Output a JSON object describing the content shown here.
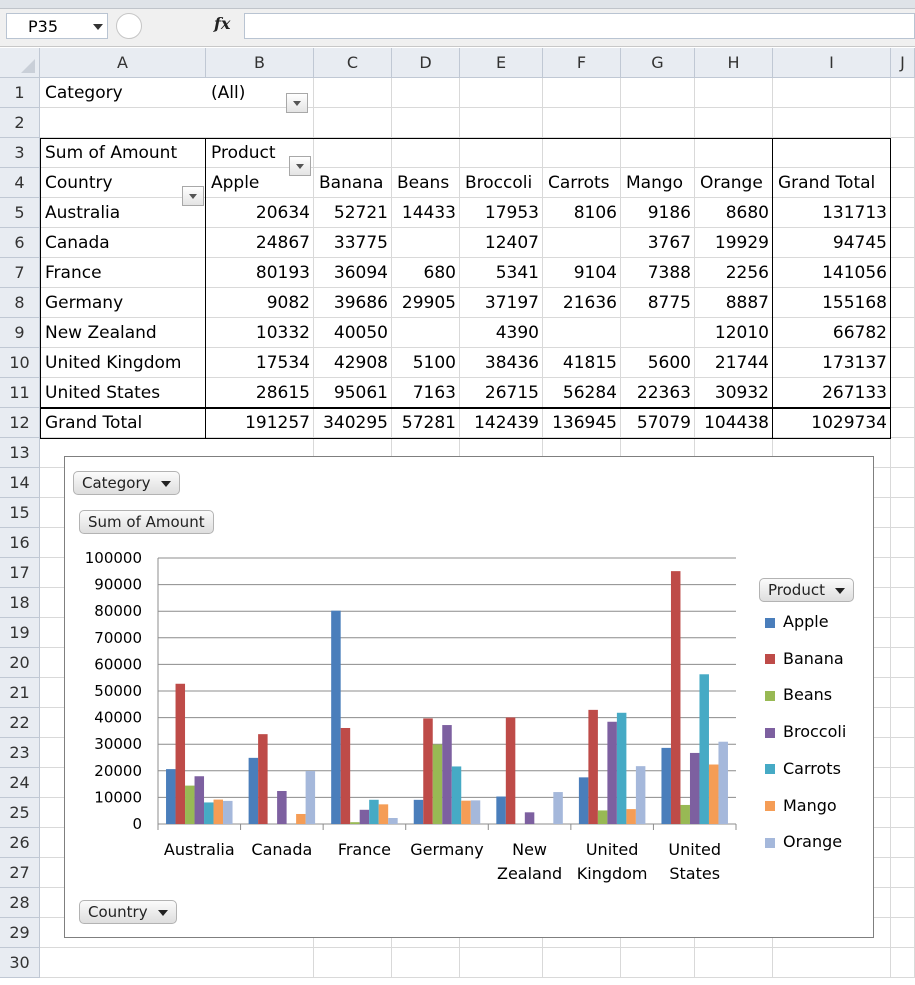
{
  "formula_bar": {
    "name_box": "P35",
    "fx_label": "fx",
    "formula": ""
  },
  "columns": [
    "A",
    "B",
    "C",
    "D",
    "E",
    "F",
    "G",
    "H",
    "I",
    "J"
  ],
  "rows": [
    "1",
    "2",
    "3",
    "4",
    "5",
    "6",
    "7",
    "8",
    "9",
    "10",
    "11",
    "12",
    "13",
    "14",
    "15",
    "16",
    "17",
    "18",
    "19",
    "20",
    "21",
    "22",
    "23",
    "24",
    "25",
    "26",
    "27",
    "28",
    "29",
    "30"
  ],
  "pivot": {
    "filter_label": "Category",
    "filter_value": "(All)",
    "values_label": "Sum of Amount",
    "column_field": "Product",
    "row_field": "Country",
    "products": [
      "Apple",
      "Banana",
      "Beans",
      "Broccoli",
      "Carrots",
      "Mango",
      "Orange"
    ],
    "grand_total_label": "Grand Total",
    "body": [
      {
        "country": "Australia",
        "cells": [
          "20634",
          "52721",
          "14433",
          "17953",
          "8106",
          "9186",
          "8680"
        ],
        "total": "131713"
      },
      {
        "country": "Canada",
        "cells": [
          "24867",
          "33775",
          "",
          "12407",
          "",
          "3767",
          "19929"
        ],
        "total": "94745"
      },
      {
        "country": "France",
        "cells": [
          "80193",
          "36094",
          "680",
          "5341",
          "9104",
          "7388",
          "2256"
        ],
        "total": "141056"
      },
      {
        "country": "Germany",
        "cells": [
          "9082",
          "39686",
          "29905",
          "37197",
          "21636",
          "8775",
          "8887"
        ],
        "total": "155168"
      },
      {
        "country": "New Zealand",
        "cells": [
          "10332",
          "40050",
          "",
          "4390",
          "",
          "",
          "12010"
        ],
        "total": "66782"
      },
      {
        "country": "United Kingdom",
        "cells": [
          "17534",
          "42908",
          "5100",
          "38436",
          "41815",
          "5600",
          "21744"
        ],
        "total": "173137"
      },
      {
        "country": "United States",
        "cells": [
          "28615",
          "95061",
          "7163",
          "26715",
          "56284",
          "22363",
          "30932"
        ],
        "total": "267133"
      }
    ],
    "grand_totals": [
      "191257",
      "340295",
      "57281",
      "142439",
      "136945",
      "57079",
      "104438"
    ],
    "grand_total_all": "1029734"
  },
  "chart_buttons": {
    "category": "Category",
    "values": "Sum of Amount",
    "legend": "Product",
    "axis": "Country"
  },
  "chart_data": {
    "type": "bar",
    "title": "",
    "xlabel": "",
    "ylabel": "",
    "ylim": [
      0,
      100000
    ],
    "yticks": [
      0,
      10000,
      20000,
      30000,
      40000,
      50000,
      60000,
      70000,
      80000,
      90000,
      100000
    ],
    "grid": true,
    "legend": "right",
    "categories": [
      [
        "Australia"
      ],
      [
        "Canada"
      ],
      [
        "France"
      ],
      [
        "Germany"
      ],
      [
        "New",
        "Zealand"
      ],
      [
        "United",
        "Kingdom"
      ],
      [
        "United",
        "States"
      ]
    ],
    "series": [
      {
        "name": "Apple",
        "color": "#4a7ebb",
        "values": [
          20634,
          24867,
          80193,
          9082,
          10332,
          17534,
          28615
        ]
      },
      {
        "name": "Banana",
        "color": "#be4b48",
        "values": [
          52721,
          33775,
          36094,
          39686,
          40050,
          42908,
          95061
        ]
      },
      {
        "name": "Beans",
        "color": "#98b954",
        "values": [
          14433,
          0,
          680,
          29905,
          0,
          5100,
          7163
        ]
      },
      {
        "name": "Broccoli",
        "color": "#7d60a0",
        "values": [
          17953,
          12407,
          5341,
          37197,
          4390,
          38436,
          26715
        ]
      },
      {
        "name": "Carrots",
        "color": "#46aac5",
        "values": [
          8106,
          0,
          9104,
          21636,
          0,
          41815,
          56284
        ]
      },
      {
        "name": "Mango",
        "color": "#f59d56",
        "values": [
          9186,
          3767,
          7388,
          8775,
          0,
          5600,
          22363
        ]
      },
      {
        "name": "Orange",
        "color": "#a5b8db",
        "values": [
          8680,
          19929,
          2256,
          8887,
          12010,
          21744,
          30932
        ]
      }
    ]
  }
}
